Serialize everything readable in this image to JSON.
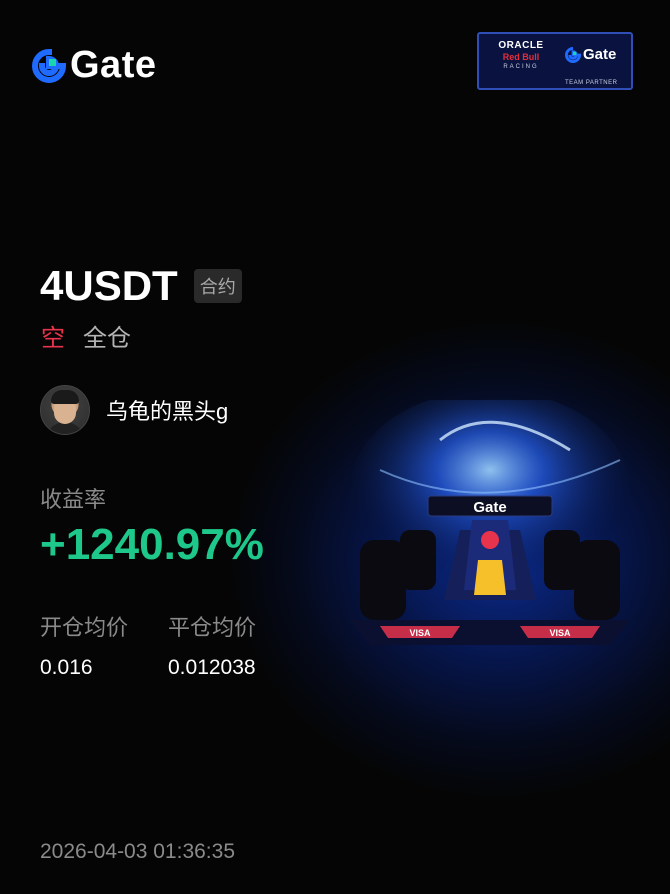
{
  "brand": {
    "name": "Gate",
    "color": "#1f6bff"
  },
  "partner": {
    "oracle": "ORACLE",
    "redbull": "Red Bull",
    "racing": "RACING",
    "gate": "Gate",
    "tag": "TEAM PARTNER"
  },
  "position": {
    "symbol": "4USDT",
    "contract_label": "合约",
    "side": "空",
    "margin_mode": "全仓"
  },
  "user": {
    "name": "乌龟的黑头g"
  },
  "roi": {
    "label": "收益率",
    "value": "+1240.97%"
  },
  "prices": {
    "open_label": "开仓均价",
    "open_value": "0.016",
    "close_label": "平仓均价",
    "close_value": "0.012038"
  },
  "timestamp": "2026-04-03 01:36:35",
  "colors": {
    "positive": "#1ec88b",
    "short": "#e8334d",
    "muted": "#8a8a8a"
  }
}
